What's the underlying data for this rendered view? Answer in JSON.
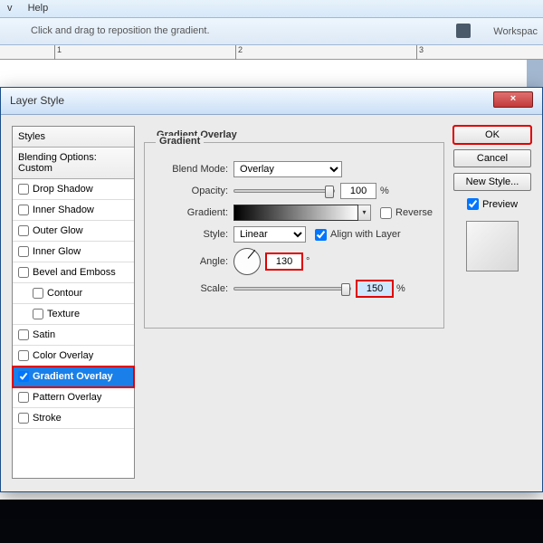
{
  "menu": {
    "item1": "v",
    "item2": "Help"
  },
  "optionsbar": {
    "hint": "Click and drag to reposition the gradient.",
    "workspace": "Workspac"
  },
  "ruler": {
    "t1": "1",
    "t2": "2",
    "t3": "3"
  },
  "dialog": {
    "title": "Layer Style",
    "close": "×"
  },
  "styles": {
    "header": "Styles",
    "blending": "Blending Options: Custom",
    "drop_shadow": "Drop Shadow",
    "inner_shadow": "Inner Shadow",
    "outer_glow": "Outer Glow",
    "inner_glow": "Inner Glow",
    "bevel": "Bevel and Emboss",
    "contour": "Contour",
    "texture": "Texture",
    "satin": "Satin",
    "color_overlay": "Color Overlay",
    "gradient_overlay": "Gradient Overlay",
    "pattern_overlay": "Pattern Overlay",
    "stroke": "Stroke"
  },
  "panel": {
    "title": "Gradient Overlay",
    "legend": "Gradient",
    "blend_mode_label": "Blend Mode:",
    "blend_mode_value": "Overlay",
    "opacity_label": "Opacity:",
    "opacity_value": "100",
    "percent": "%",
    "gradient_label": "Gradient:",
    "reverse": "Reverse",
    "style_label": "Style:",
    "style_value": "Linear",
    "align": "Align with Layer",
    "angle_label": "Angle:",
    "angle_value": "130",
    "degree": "°",
    "scale_label": "Scale:",
    "scale_value": "150"
  },
  "buttons": {
    "ok": "OK",
    "cancel": "Cancel",
    "new_style": "New Style...",
    "preview": "Preview"
  }
}
